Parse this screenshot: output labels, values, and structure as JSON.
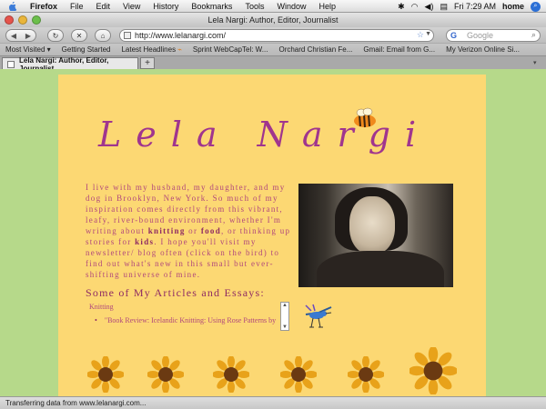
{
  "menubar": {
    "app": "Firefox",
    "items": [
      "File",
      "Edit",
      "View",
      "History",
      "Bookmarks",
      "Tools",
      "Window",
      "Help"
    ],
    "clock": "Fri 7:29 AM",
    "user": "home"
  },
  "window": {
    "title": "Lela Nargi: Author, Editor, Journalist"
  },
  "navbar": {
    "url": "http://www.lelanargi.com/",
    "search_placeholder": "Google"
  },
  "bookmarks": [
    "Most Visited ▾",
    "Getting Started",
    "Latest Headlines",
    "Sprint WebCapTel: W...",
    "Orchard Christian Fe...",
    "Gmail: Email from G...",
    "My Verizon Online Si..."
  ],
  "tab": {
    "label": "Lela Nargi: Author, Editor, Journalist",
    "new_tab": "+"
  },
  "page": {
    "logo": "Lela Nargi",
    "intro_1": "I live with my husband, my daughter, and my dog in Brooklyn, New York. So much of my inspiration comes directly from this vibrant, leafy, river-bound environment, whether I'm writing about ",
    "intro_knitting": "knitting",
    "intro_or": " or ",
    "intro_food": "food",
    "intro_2": ", or thinking up stories for ",
    "intro_kids": "kids",
    "intro_3": ". I hope you'll visit my newsletter/ blog often (click on the bird) to find out what's new in this small but ever-shifting universe of mine.",
    "section_title": "Some of My Articles and Essays:",
    "category": "Knitting",
    "articles": [
      "\"Book Review: Icelandic Knitting: Using Rose Patterns by"
    ]
  },
  "status": {
    "text": "Transferring data from www.lelanargi.com..."
  },
  "colors": {
    "page_bg": "#fcd873",
    "side_bg": "#b6d98a",
    "text_accent": "#a0358e"
  }
}
